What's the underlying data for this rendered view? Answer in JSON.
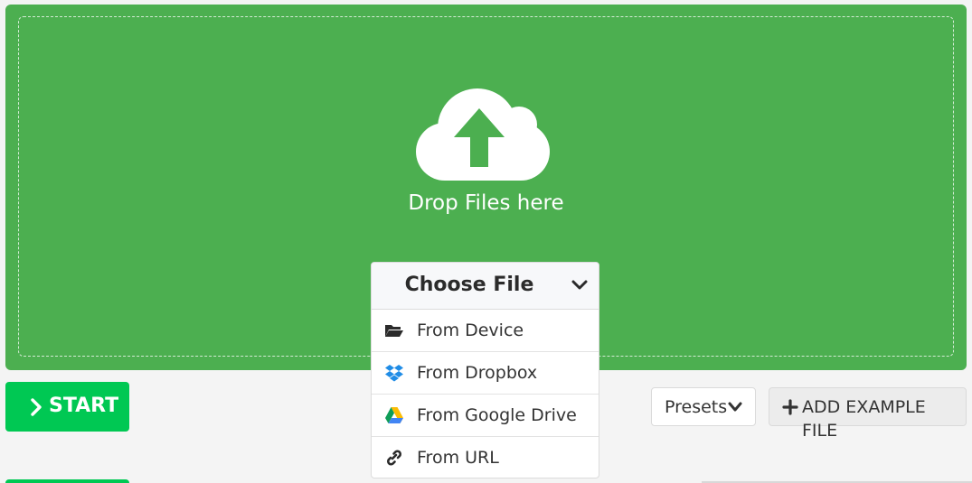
{
  "dropzone": {
    "drop_text": "Drop Files here",
    "icon": "cloud-upload-icon",
    "color": "#4caf50"
  },
  "chooser": {
    "label": "Choose File",
    "items": [
      {
        "label": "From Device",
        "icon": "folder-open-icon"
      },
      {
        "label": "From Dropbox",
        "icon": "dropbox-icon"
      },
      {
        "label": "From Google Drive",
        "icon": "google-drive-icon"
      },
      {
        "label": "From URL",
        "icon": "link-icon"
      }
    ]
  },
  "actions": {
    "start_label": "START",
    "presets_label": "Presets",
    "add_example_label": "ADD EXAMPLE FILE",
    "start_color": "#00c853"
  }
}
